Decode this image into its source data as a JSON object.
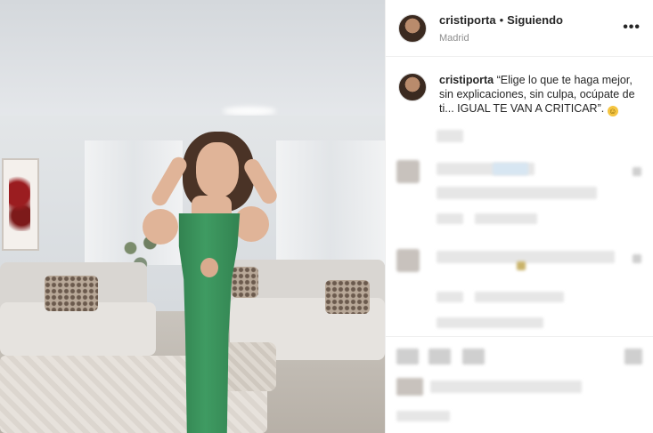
{
  "post": {
    "username": "cristiporta",
    "separator": "•",
    "follow_label": "Siguiendo",
    "location": "Madrid",
    "more_icon": "more-options-icon",
    "more_glyph": "•••",
    "caption_username": "cristiporta",
    "caption_text": "“Elige lo que te haga mejor, sin explicaciones, sin culpa, ocúpate de ti... IGUAL TE VAN A CRITICAR”.",
    "caption_emoji": "☺"
  },
  "colors": {
    "dress": "#3f9b62",
    "text": "#262626",
    "muted": "#8e8e8e"
  }
}
